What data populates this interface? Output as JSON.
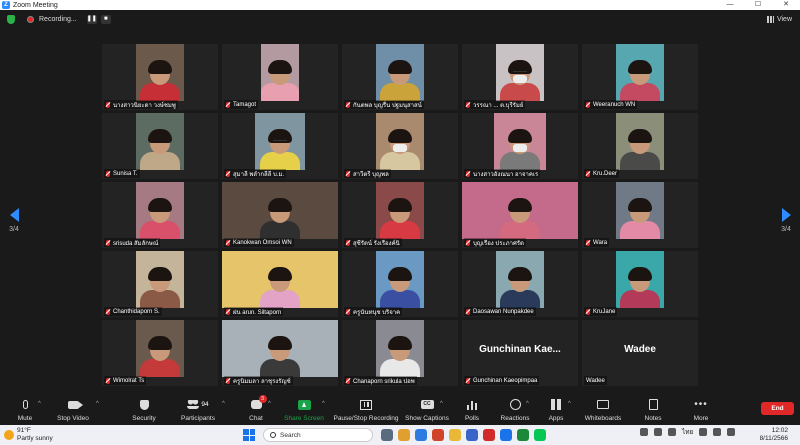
{
  "window": {
    "title": "Zoom Meeting",
    "controls": [
      "—",
      "☐",
      "✕"
    ]
  },
  "topbar": {
    "recording_label": "Recording...",
    "pause_glyph": "❚❚",
    "stop_glyph": "■",
    "view_label": "View"
  },
  "gallery": {
    "page_left": "3/4",
    "page_right": "3/4",
    "tiles": [
      {
        "name": "นางสาวนิยะดา วงษ์ชมพู",
        "video": true,
        "bg": "#6b5a4c",
        "shirt": "#c62f36"
      },
      {
        "name": "Tamagot",
        "video": true,
        "bg": "#b39aa0",
        "shirt": "#e8a0b0"
      },
      {
        "name": "กันตพล บุญรื่น ปฐมนุสาสน์",
        "video": true,
        "bg": "#6f8fa8",
        "shirt": "#caa43a"
      },
      {
        "name": "วรรณา ... ต.บุรีรัมย์",
        "video": true,
        "bg": "#c9c2c4",
        "shirt": "#c94a4a"
      },
      {
        "name": "Weeranuch WN",
        "video": true,
        "bg": "#56a7b0",
        "shirt": "#c44a62"
      },
      {
        "name": "Sunisa T.",
        "video": true,
        "bg": "#5c6c62",
        "shirt": "#bfa888"
      },
      {
        "name": "สุมาลี พลำกลีลี บ.ม.",
        "video": true,
        "bg": "#7f96a0",
        "shirt": "#e6d04a"
      },
      {
        "name": "สาวีตรี บุญพล",
        "video": true,
        "bg": "#a98a6e",
        "shirt": "#d6c7a0"
      },
      {
        "name": "นางสาวอังณนา อาจาคเร",
        "video": true,
        "bg": "#c88696",
        "shirt": "#7a7a7a"
      },
      {
        "name": "Kru.Deer",
        "video": true,
        "bg": "#8b8f7a",
        "shirt": "#4a4a48"
      },
      {
        "name": "srisuda สัมลักษณ์",
        "video": true,
        "bg": "#a57a82",
        "shirt": "#d8506a"
      },
      {
        "name": "Kanokwan Omsoi WN",
        "video": true,
        "bg": "#5a4a40",
        "shirt": "#2f2f2f"
      },
      {
        "name": "สุชีรัตน์ รังเรืองค์นิ",
        "video": true,
        "bg": "#8a4a4a",
        "shirt": "#d83a44"
      },
      {
        "name": "บุญเรือง ประภาศรัต",
        "video": true,
        "bg": "#c46a8a",
        "shirt": "#d46a80"
      },
      {
        "name": "Wara",
        "video": true,
        "bg": "#6f7a86",
        "shirt": "#e38aa6"
      },
      {
        "name": "Chanthidaporn S.",
        "video": true,
        "bg": "#c4b49a",
        "shirt": "#8a5a46"
      },
      {
        "name": "ฝน arun. Siltaporn",
        "video": true,
        "bg": "#e6c46a",
        "shirt": "#e2a3c6"
      },
      {
        "name": "ครูนันทนุช บริจาค",
        "video": true,
        "bg": "#6a9ac4",
        "shirt": "#3a4fa2"
      },
      {
        "name": "Daosawan Nunpakdee",
        "video": true,
        "bg": "#8aa8b0",
        "shirt": "#2a3a5a"
      },
      {
        "name": "KruJane",
        "video": true,
        "bg": "#3aa8a8",
        "shirt": "#b43a5a"
      },
      {
        "name": "Wimolrat Ts",
        "video": true,
        "bg": "#6a5a4e",
        "shirt": "#c43a3a"
      },
      {
        "name": "ครูนิมมลา ลาชุรงรัญช์",
        "video": true,
        "bg": "#a8b0b8",
        "shirt": "#3a3a3a"
      },
      {
        "name": "Chanaporn srikula ปอพ",
        "video": true,
        "bg": "#8a8a92",
        "shirt": "#e8e8e8"
      },
      {
        "name": "Gunchinan Kaeopimpaa",
        "video": false,
        "display": "Gunchinan  Kae..."
      },
      {
        "name": "Wadee",
        "video": false,
        "display": "Wadee",
        "muted": false
      }
    ]
  },
  "toolbar": {
    "mute": "Mute",
    "stop_video": "Stop Video",
    "security": "Security",
    "participants": "Participants",
    "participants_count": "94",
    "chat": "Chat",
    "chat_badge": "3",
    "share_screen": "Share Screen",
    "pause_recording": "Pause/Stop Recording",
    "captions": "Show Captions",
    "captions_icon": "CC",
    "polls": "Polls",
    "reactions": "Reactions",
    "apps": "Apps",
    "whiteboards": "Whiteboards",
    "notes": "Notes",
    "more": "More",
    "more_glyph": "•••",
    "end": "End"
  },
  "taskbar": {
    "temp": "91°F",
    "weather": "Partly sunny",
    "search_placeholder": "Search",
    "lang": "ไทย",
    "time": "12:02",
    "date": "8/11/2566"
  },
  "colors": {
    "accent": "#2d8cff",
    "end": "#e02828",
    "share": "#1ba34a"
  }
}
